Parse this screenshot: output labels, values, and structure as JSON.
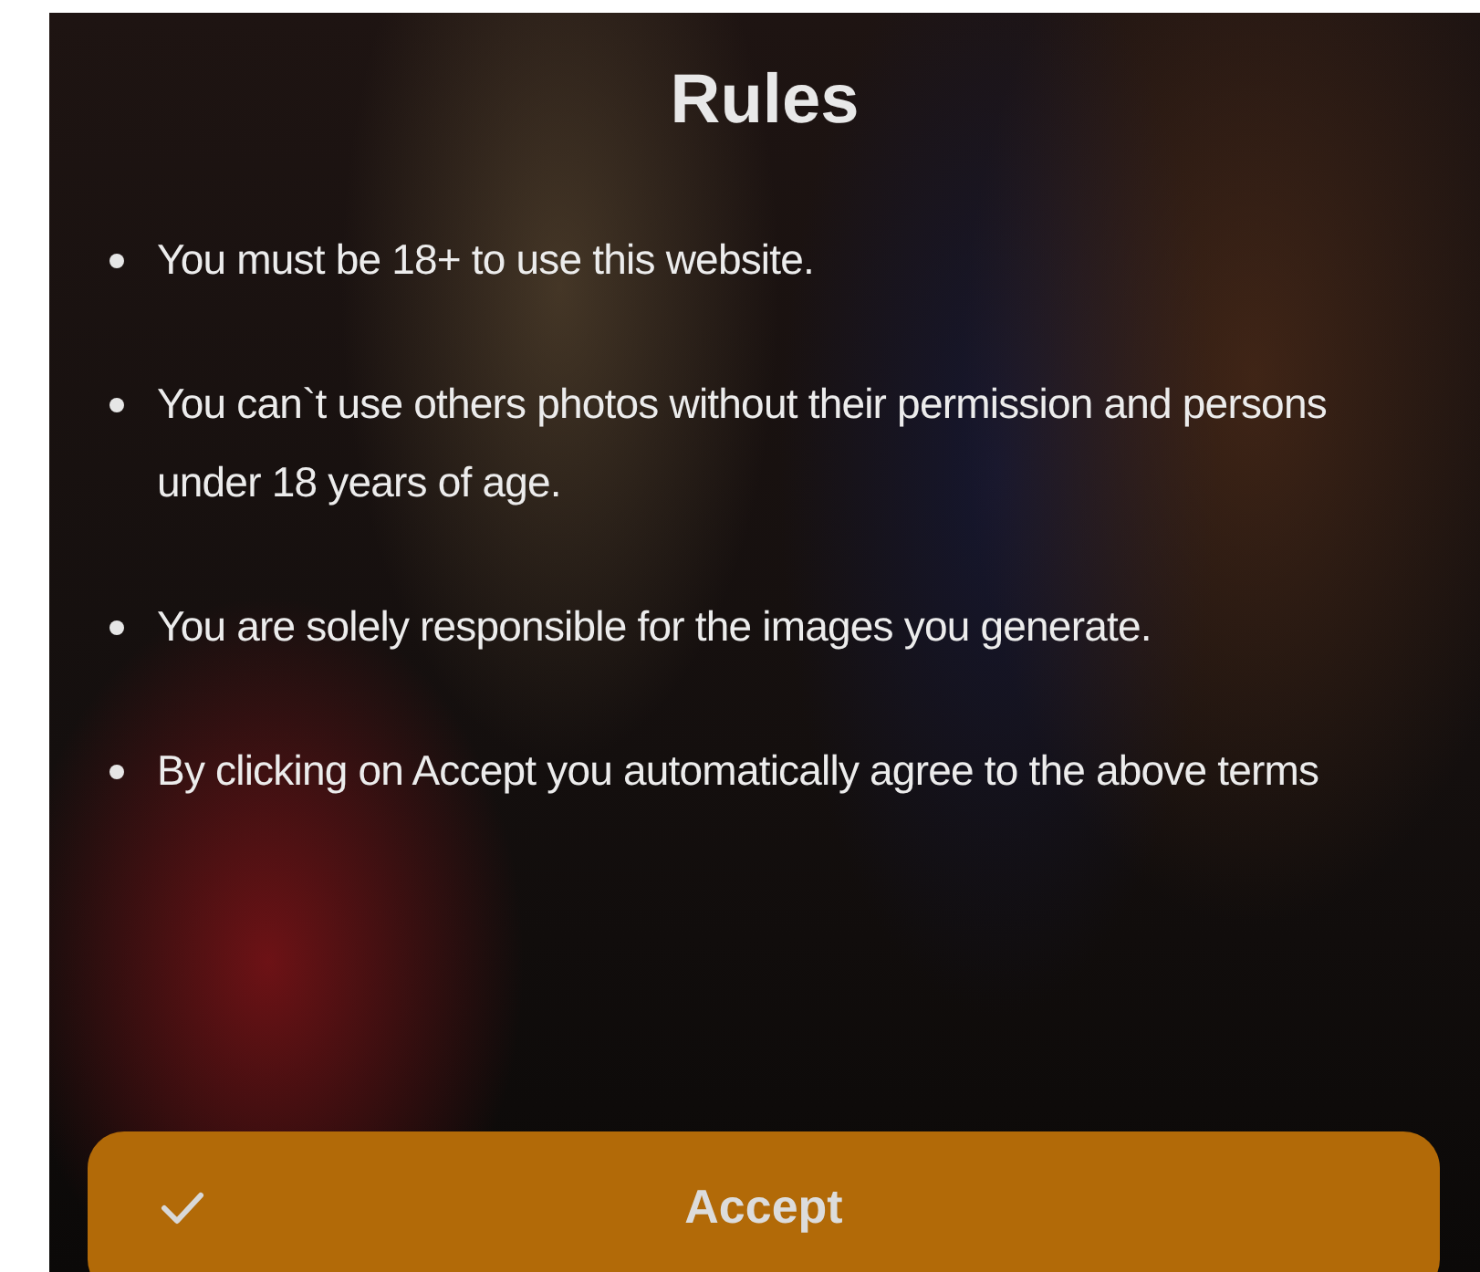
{
  "title": "Rules",
  "rules": [
    "You must be 18+ to use this website.",
    "You can`t use others photos without their permission and persons under 18 years of age.",
    "You are solely responsible for the images you generate.",
    "By clicking on Accept you automatically agree to the above terms"
  ],
  "accept_button": {
    "label": "Accept"
  }
}
